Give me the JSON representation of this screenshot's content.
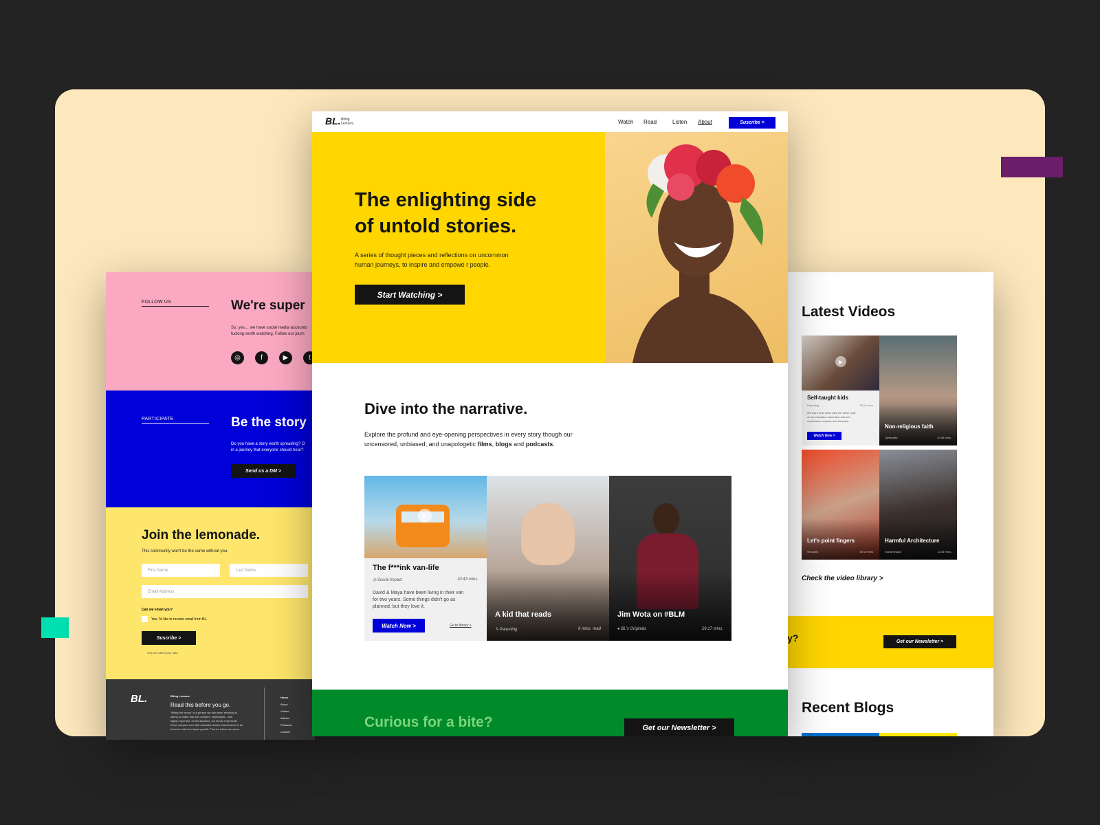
{
  "brand": {
    "logo": "BL.",
    "tagline_line1": "Biting",
    "tagline_line2": "Lemons."
  },
  "colors": {
    "bg": "#232323",
    "cream": "#FDE7BD",
    "yellow": "#FFD600",
    "blue": "#0000D8",
    "pink": "#FBA9C3",
    "green": "#008A2A",
    "purple": "#6B1E6B",
    "teal": "#00E0B0"
  },
  "nav": {
    "items": [
      "Watch",
      "Read",
      "Listen",
      "About"
    ],
    "subscribe": "Suscribe >"
  },
  "hero": {
    "title_line1": "The enlighting side",
    "title_line2": "of untold stories.",
    "sub_line1": "A series of thought pieces and reflections on uncommon",
    "sub_line2": "human journeys, to inspire and empowe r people.",
    "cta": "Start Watching >"
  },
  "narrative": {
    "title": "Dive into the narrative.",
    "body_line1": "Explore the profund and eye-opening perspectives in every story though our",
    "body_line2_prefix": "uncensored, unbiased, and unapologetic ",
    "films": "films",
    "sep1": ", ",
    "blogs": "blogs",
    "and": " and ",
    "podcasts": "podcasts",
    "period": "."
  },
  "cards": [
    {
      "title": "The f***ink van-life",
      "category": "Social Impact",
      "duration": "10:43 mins.",
      "body_line1": "David & Maya have been living in their van",
      "body_line2": "for two years. Some things didn't go as",
      "body_line3": "planned, but they love it.",
      "cta": "Watch Now >",
      "link": "Go to library >"
    },
    {
      "title": "A kid that reads",
      "category": "Parenting",
      "duration": "6 mins. read"
    },
    {
      "title": "Jim Wota on #BLM",
      "category": "BL's Originals",
      "duration": "29:17 mins."
    }
  ],
  "curious": {
    "title": "Curious for a bite?",
    "cta": "Get our Newsletter >"
  },
  "left": {
    "follow_label": "FOLLOW US",
    "follow_title": "We're super",
    "follow_body_line1": "So, yes… we have social media accounts",
    "follow_body_line2": "fucking worth watching. Follow our journ",
    "participate_label": "PARTICIPATE",
    "participate_title": "Be the story",
    "participate_body_line1": "Do you have a story worth spreading? O",
    "participate_body_line2": "in a journey that everyone should hear?",
    "participate_cta": "Send us a DM >",
    "join_title": "Join the lemonade.",
    "join_sub": "This community won't be the same without you.",
    "first_name": "First Name",
    "last_name": "Last Name",
    "email": "Email Address",
    "email_q": "Can we email you?",
    "consent": "Yes, I'd like to receive email from BL.",
    "subscribe": "Suscribe >",
    "why": "Why we collect your data",
    "footer_brand": "Biting Lemons",
    "footer_title": "Read this before you go.",
    "footer_body_line1": "\"Biting the lemon\" is a phrase we use when referring to",
    "footer_body_line2": "taking on tasks that are complex, unpleasant – and",
    "footer_body_line3": "highly important. In this situation, our lemon represents",
    "footer_body_line4": "these complex and often dreaded stories that deserve to be",
    "footer_body_line5": "heard in order to inspire growth. There's where we come",
    "footer_links": [
      "Home",
      "About",
      "Videos",
      "Articles",
      "Podcasts",
      "Contact"
    ]
  },
  "right": {
    "latest_title": "Latest Videos",
    "videos": [
      {
        "title": "Self-taught kids",
        "category": "Parenting",
        "duration": "23:13 mins.",
        "body_line1": "We learn best when take the driver seat",
        "body_line2": "of our education adventure and set",
        "body_line3": "ourselves to explore and innovate.",
        "cta": "Watch Now >"
      },
      {
        "title": "Non-religious faith",
        "category": "Spirituality",
        "duration": "20:45 mins."
      },
      {
        "title": "Let's point fingers",
        "category": "Sexuality",
        "duration": "19:14 mins."
      },
      {
        "title": "Harmful Architecture",
        "category": "Social Impact",
        "duration": "12:36 mins."
      }
    ],
    "library_link": "Check the video library >",
    "partial_q": "y?",
    "newsletter": "Get our Newsletter >",
    "recent_title": "Recent Blogs"
  }
}
